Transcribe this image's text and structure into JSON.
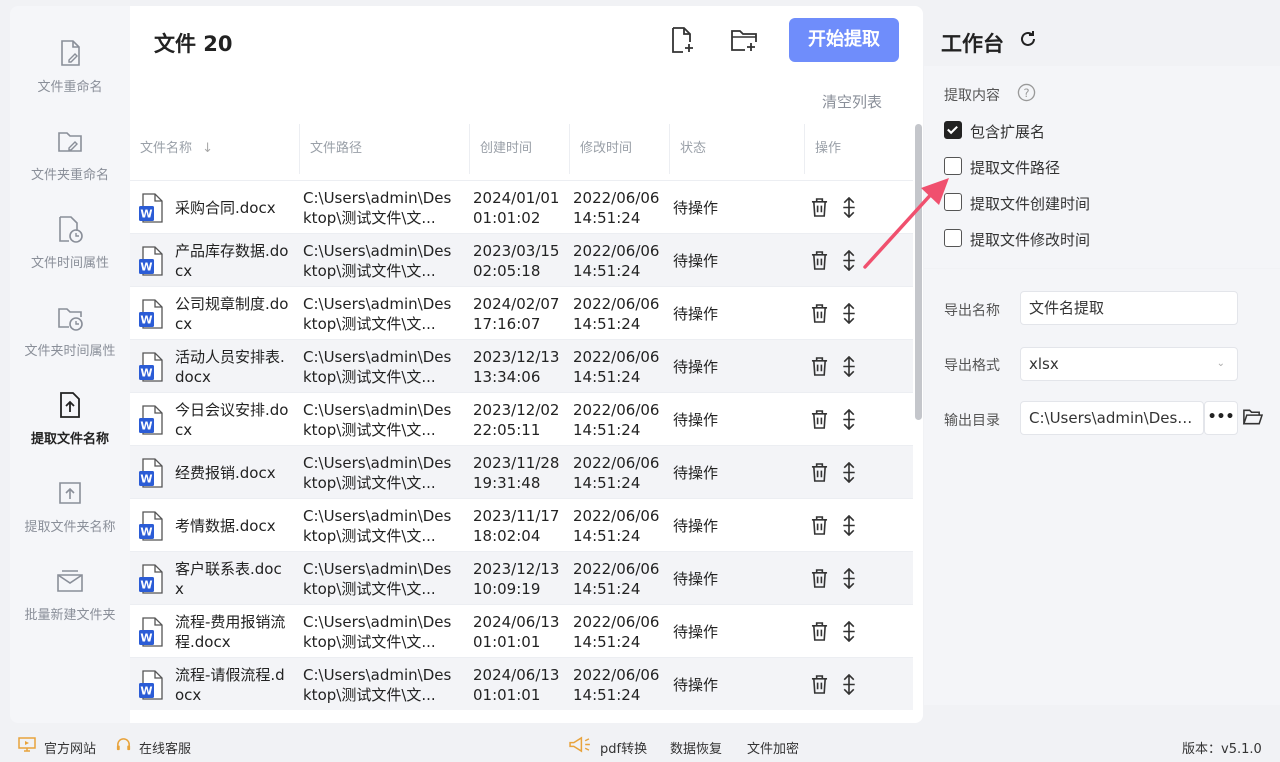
{
  "sidebar": {
    "items": [
      {
        "label": "文件重命名",
        "icon": "file-edit-icon"
      },
      {
        "label": "文件夹重命名",
        "icon": "folder-edit-icon"
      },
      {
        "label": "文件时间属性",
        "icon": "file-clock-icon"
      },
      {
        "label": "文件夹时间属性",
        "icon": "folder-clock-icon"
      },
      {
        "label": "提取文件名称",
        "icon": "file-upload-icon",
        "active": true
      },
      {
        "label": "提取文件夹名称",
        "icon": "folder-upload-icon"
      },
      {
        "label": "批量新建文件夹",
        "icon": "folder-batch-icon"
      }
    ]
  },
  "main": {
    "title": "文件 20",
    "start_button": "开始提取",
    "clear_list": "清空列表",
    "columns": [
      "文件名称",
      "文件路径",
      "创建时间",
      "修改时间",
      "状态",
      "操作"
    ],
    "rows": [
      {
        "name": "采购合同.docx",
        "path": "C:\\Users\\admin\\Desktop\\测试文件\\文...",
        "created": "2024/01/01 01:01:02",
        "modified": "2022/06/06 14:51:24",
        "status": "待操作"
      },
      {
        "name": "产品库存数据.docx",
        "path": "C:\\Users\\admin\\Desktop\\测试文件\\文...",
        "created": "2023/03/15 02:05:18",
        "modified": "2022/06/06 14:51:24",
        "status": "待操作"
      },
      {
        "name": "公司规章制度.docx",
        "path": "C:\\Users\\admin\\Desktop\\测试文件\\文...",
        "created": "2024/02/07 17:16:07",
        "modified": "2022/06/06 14:51:24",
        "status": "待操作"
      },
      {
        "name": "活动人员安排表.docx",
        "path": "C:\\Users\\admin\\Desktop\\测试文件\\文...",
        "created": "2023/12/13 13:34:06",
        "modified": "2022/06/06 14:51:24",
        "status": "待操作"
      },
      {
        "name": "今日会议安排.docx",
        "path": "C:\\Users\\admin\\Desktop\\测试文件\\文...",
        "created": "2023/12/02 22:05:11",
        "modified": "2022/06/06 14:51:24",
        "status": "待操作"
      },
      {
        "name": "经费报销.docx",
        "path": "C:\\Users\\admin\\Desktop\\测试文件\\文...",
        "created": "2023/11/28 19:31:48",
        "modified": "2022/06/06 14:51:24",
        "status": "待操作"
      },
      {
        "name": "考情数据.docx",
        "path": "C:\\Users\\admin\\Desktop\\测试文件\\文...",
        "created": "2023/11/17 18:02:04",
        "modified": "2022/06/06 14:51:24",
        "status": "待操作"
      },
      {
        "name": "客户联系表.docx",
        "path": "C:\\Users\\admin\\Desktop\\测试文件\\文...",
        "created": "2023/12/13 10:09:19",
        "modified": "2022/06/06 14:51:24",
        "status": "待操作"
      },
      {
        "name": "流程-费用报销流程.docx",
        "path": "C:\\Users\\admin\\Desktop\\测试文件\\文...",
        "created": "2024/06/13 01:01:01",
        "modified": "2022/06/06 14:51:24",
        "status": "待操作"
      },
      {
        "name": "流程-请假流程.docx",
        "path": "C:\\Users\\admin\\Desktop\\测试文件\\文...",
        "created": "2024/06/13 01:01:01",
        "modified": "2022/06/06 14:51:24",
        "status": "待操作"
      }
    ]
  },
  "workspace": {
    "title": "工作台",
    "extract_label": "提取内容",
    "options": [
      {
        "label": "包含扩展名",
        "checked": true
      },
      {
        "label": "提取文件路径",
        "checked": false
      },
      {
        "label": "提取文件创建时间",
        "checked": false
      },
      {
        "label": "提取文件修改时间",
        "checked": false
      }
    ],
    "export_name_label": "导出名称",
    "export_name_value": "文件名提取",
    "export_format_label": "导出格式",
    "export_format_value": "xlsx",
    "output_dir_label": "输出目录",
    "output_dir_value": "C:\\Users\\admin\\Desktop\\",
    "more_label": "•••"
  },
  "footer": {
    "website": "官方网站",
    "support": "在线客服",
    "pdf": "pdf转换",
    "recovery": "数据恢复",
    "encrypt": "文件加密",
    "version": "版本：v5.1.0"
  },
  "colors": {
    "accent": "#6f8dfb",
    "word_blue": "#2b5cd6",
    "arrow": "#f0506e"
  }
}
